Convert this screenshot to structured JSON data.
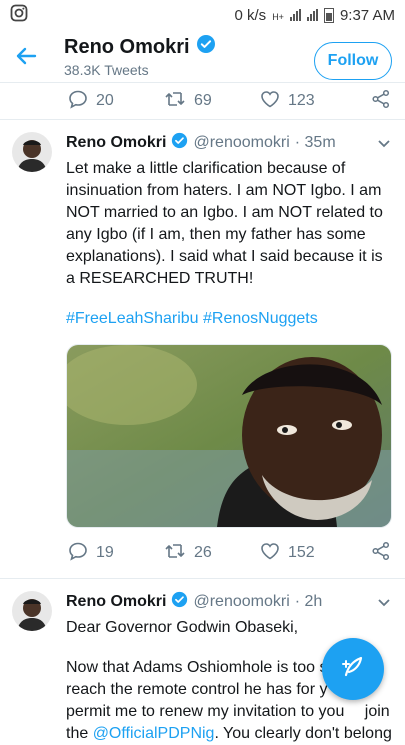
{
  "status": {
    "speed": "0 k/s",
    "network": "H+",
    "time": "9:37 AM"
  },
  "header": {
    "name": "Reno Omokri",
    "subtitle": "38.3K Tweets",
    "follow_label": "Follow"
  },
  "prev_actions": {
    "replies": "20",
    "retweets": "69",
    "likes": "123"
  },
  "tweets": [
    {
      "name": "Reno Omokri",
      "handle": "@renoomokri",
      "time": "· 35m",
      "text": "Let make a little clarification because of insinuation from haters. I am NOT Igbo. I am NOT married to an Igbo. I am NOT related to any Igbo (if I am, then my father has some explanations). I said what I said because it is a RESEARCHED TRUTH!",
      "hashtags": "#FreeLeahSharibu #RenosNuggets",
      "replies": "19",
      "retweets": "26",
      "likes": "152"
    },
    {
      "name": "Reno Omokri",
      "handle": "@renoomokri",
      "time": "· 2h",
      "greeting": "Dear Governor Godwin Obaseki,",
      "line1": "Now that Adams Oshiomhole is too sh",
      "line2": "reach the remote control he has for y",
      "line3": "permit me to renew my invitation to you",
      "line3_tail": "join",
      "line4_pre": "the ",
      "line4_link": "@OfficialPDPNig",
      "line4_post": ". You clearly don't belong"
    }
  ],
  "colors": {
    "accent": "#1da1f2",
    "muted": "#657786"
  }
}
